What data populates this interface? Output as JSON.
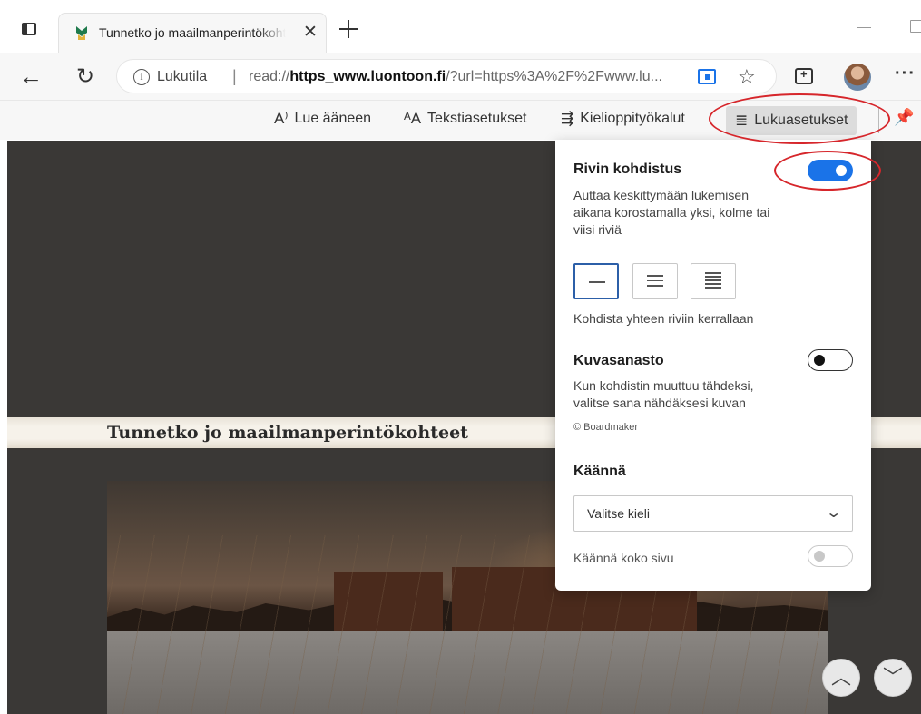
{
  "browser": {
    "tab": {
      "title": "Tunnetko jo maailmanperintökohteet",
      "close_label": "✕",
      "new_tab_label": "+"
    },
    "address_bar": {
      "mode_label": "Lukutila",
      "separator": "|",
      "url_prefix": "read://",
      "url_domain": "https_www.luontoon.fi",
      "url_rest": "/?url=https%3A%2F%2Fwww.lu..."
    },
    "more_label": "···"
  },
  "reader_toolbar": {
    "read_aloud": {
      "icon": "A⁾",
      "label": "Lue ääneen"
    },
    "text_preferences": {
      "icon": "ᴬA",
      "label": "Tekstiasetukset"
    },
    "grammar_tools": {
      "icon": "⇶",
      "label": "Kielioppityökalut"
    },
    "reading_preferences": {
      "icon": "≣",
      "label": "Lukuasetukset"
    },
    "pin_icon": "pin-icon"
  },
  "article": {
    "title": "Tunnetko jo maailmanperintökohteet"
  },
  "panel": {
    "line_focus": {
      "heading": "Rivin kohdistus",
      "description": "Auttaa keskittymään lukemisen aikana korostamalla yksi, kolme tai viisi riviä",
      "enabled": true,
      "selected_option": 1,
      "caption": "Kohdista yhteen riviin kerrallaan"
    },
    "picture_dictionary": {
      "heading": "Kuvasanasto",
      "description": "Kun kohdistin muuttuu tähdeksi, valitse sana nähdäksesi kuvan",
      "credit": "© Boardmaker",
      "enabled": false
    },
    "translate": {
      "heading": "Käännä",
      "select_value": "Valitse kieli",
      "full_page_label": "Käännä koko sivu",
      "full_page_enabled": false
    }
  },
  "colors": {
    "accent": "#1a73e8",
    "callout": "#d6262b",
    "content_background": "#3a3836"
  }
}
